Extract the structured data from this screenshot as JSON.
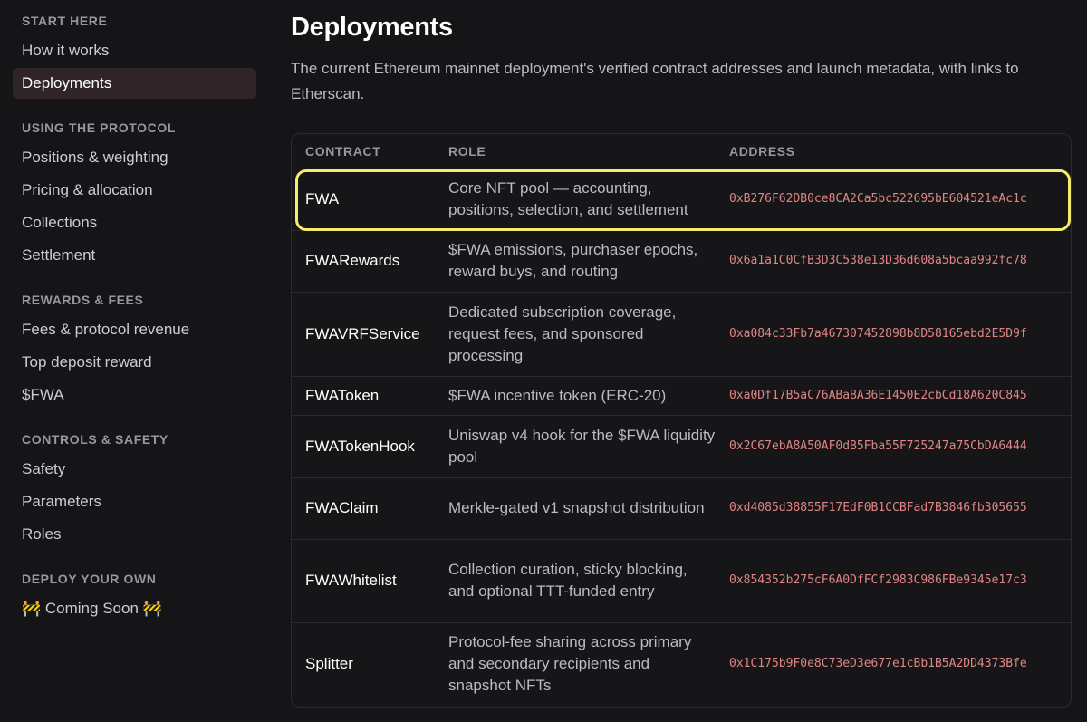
{
  "sidebar": {
    "sections": [
      {
        "heading": "START HERE",
        "items": [
          "How it works",
          "Deployments"
        ]
      },
      {
        "heading": "USING THE PROTOCOL",
        "items": [
          "Positions & weighting",
          "Pricing & allocation",
          "Collections",
          "Settlement"
        ]
      },
      {
        "heading": "REWARDS & FEES",
        "items": [
          "Fees & protocol revenue",
          "Top deposit reward",
          "$FWA"
        ]
      },
      {
        "heading": "CONTROLS & SAFETY",
        "items": [
          "Safety",
          "Parameters",
          "Roles"
        ]
      },
      {
        "heading": "DEPLOY YOUR OWN",
        "items": [
          "🚧 Coming Soon 🚧"
        ]
      }
    ],
    "active_item": "Deployments"
  },
  "main": {
    "title": "Deployments",
    "description": "The current Ethereum mainnet deployment's verified contract addresses and launch metadata, with links to Etherscan."
  },
  "table": {
    "headers": {
      "contract": "CONTRACT",
      "role": "ROLE",
      "address": "ADDRESS"
    },
    "rows": [
      {
        "contract": "FWA",
        "role": "Core NFT pool — accounting, positions, selection, and settlement",
        "address": "0xB276F62DB0ce8CA2Ca5bc522695bE604521eAc1c"
      },
      {
        "contract": "FWARewards",
        "role": "$FWA emissions, purchaser epochs, reward buys, and routing",
        "address": "0x6a1a1C0CfB3D3C538e13D36d608a5bcaa992fc78"
      },
      {
        "contract": "FWAVRFService",
        "role": "Dedicated subscription coverage, request fees, and sponsored processing",
        "address": "0xa084c33Fb7a467307452898b8D58165ebd2E5D9f"
      },
      {
        "contract": "FWAToken",
        "role": "$FWA incentive token (ERC-20)",
        "address": "0xa0Df17B5aC76ABaBA36E1450E2cbCd18A620C845"
      },
      {
        "contract": "FWATokenHook",
        "role": "Uniswap v4 hook for the $FWA liquidity pool",
        "address": "0x2C67ebA8A50AF0dB5Fba55F725247a75CbDA6444"
      },
      {
        "contract": "FWAClaim",
        "role": "Merkle-gated v1 snapshot distribution",
        "address": "0xd4085d38855F17EdF0B1CCBFad7B3846fb305655"
      },
      {
        "contract": "FWAWhitelist",
        "role": "Collection curation, sticky blocking, and optional TTT-funded entry",
        "address": "0x854352b275cF6A0DfFCf2983C986FBe9345e17c3"
      },
      {
        "contract": "Splitter",
        "role": "Protocol-fee sharing across primary and secondary recipients and snapshot NFTs",
        "address": "0x1C175b9F0e8C73eD3e677e1cBb1B5A2DD4373Bfe"
      }
    ]
  },
  "colors": {
    "background": "#151416",
    "active_nav": "#2f2528",
    "address_text": "#e08585",
    "highlight_border": "#f4ec6a"
  }
}
